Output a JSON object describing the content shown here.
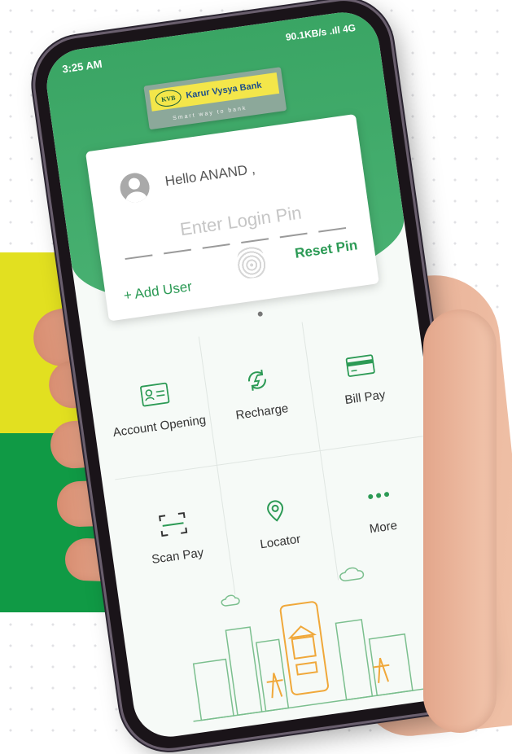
{
  "status_bar": {
    "time": "3:25 AM",
    "network": "90.1KB/s .ıll 4G"
  },
  "brand": {
    "name": "Karur Vysya Bank",
    "mark": "KVB",
    "tagline": "Smart way to bank"
  },
  "login": {
    "greeting": "Hello ANAND ,",
    "pin_placeholder": "Enter Login Pin",
    "add_user": "+ Add User",
    "reset_pin": "Reset Pin"
  },
  "services": [
    {
      "label": "Account Opening",
      "icon": "id-card-icon"
    },
    {
      "label": "Recharge",
      "icon": "recharge-icon"
    },
    {
      "label": "Bill Pay",
      "icon": "credit-card-icon"
    },
    {
      "label": "Scan Pay",
      "icon": "scan-icon"
    },
    {
      "label": "Locator",
      "icon": "location-pin-icon"
    },
    {
      "label": "More",
      "icon": "more-dots-icon"
    }
  ],
  "colors": {
    "header_green": "#3aa564",
    "accent_green": "#2c9a55",
    "logo_yellow": "#f3e64a",
    "band_yellow": "#e2e020",
    "band_green": "#109a45"
  }
}
